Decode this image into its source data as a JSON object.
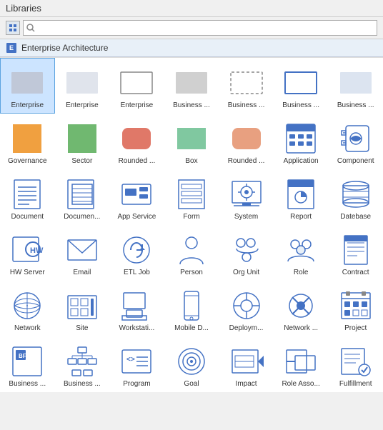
{
  "header": {
    "title": "Libraries",
    "search_placeholder": ""
  },
  "section": {
    "title": "Enterprise Architecture"
  },
  "grid": {
    "items": [
      {
        "id": "enterprise1",
        "label": "Enterprise",
        "icon": "enterprise-rect-filled"
      },
      {
        "id": "enterprise2",
        "label": "Enterprise",
        "icon": "enterprise-rect-light"
      },
      {
        "id": "enterprise3",
        "label": "Enterprise",
        "icon": "enterprise-rect-outline"
      },
      {
        "id": "business1",
        "label": "Business ...",
        "icon": "business-rect-grey"
      },
      {
        "id": "business2",
        "label": "Business ...",
        "icon": "business-rect-dashed"
      },
      {
        "id": "business3",
        "label": "Business ...",
        "icon": "business-rect-blue-outline"
      },
      {
        "id": "business4",
        "label": "Business ...",
        "icon": "business-rect-grey2"
      },
      {
        "id": "governance",
        "label": "Governance",
        "icon": "governance-orange"
      },
      {
        "id": "sector",
        "label": "Sector",
        "icon": "sector-green"
      },
      {
        "id": "rounded1",
        "label": "Rounded ...",
        "icon": "rounded-salmon"
      },
      {
        "id": "box",
        "label": "Box",
        "icon": "box-green"
      },
      {
        "id": "rounded2",
        "label": "Rounded ...",
        "icon": "rounded-peach"
      },
      {
        "id": "application",
        "label": "Application",
        "icon": "application"
      },
      {
        "id": "component",
        "label": "Component",
        "icon": "component"
      },
      {
        "id": "document",
        "label": "Document",
        "icon": "document"
      },
      {
        "id": "documentum",
        "label": "Documen...",
        "icon": "documentum"
      },
      {
        "id": "appservice",
        "label": "App Service",
        "icon": "appservice"
      },
      {
        "id": "form",
        "label": "Form",
        "icon": "form"
      },
      {
        "id": "system",
        "label": "System",
        "icon": "system"
      },
      {
        "id": "report",
        "label": "Report",
        "icon": "report"
      },
      {
        "id": "database",
        "label": "Datebase",
        "icon": "database"
      },
      {
        "id": "hwserver",
        "label": "HW Server",
        "icon": "hwserver"
      },
      {
        "id": "email",
        "label": "Email",
        "icon": "email"
      },
      {
        "id": "etljob",
        "label": "ETL Job",
        "icon": "etljob"
      },
      {
        "id": "person",
        "label": "Person",
        "icon": "person"
      },
      {
        "id": "orgunit",
        "label": "Org Unit",
        "icon": "orgunit"
      },
      {
        "id": "role",
        "label": "Role",
        "icon": "role"
      },
      {
        "id": "contract",
        "label": "Contract",
        "icon": "contract"
      },
      {
        "id": "network",
        "label": "Network",
        "icon": "network"
      },
      {
        "id": "site",
        "label": "Site",
        "icon": "site"
      },
      {
        "id": "workstation",
        "label": "Workstati...",
        "icon": "workstation"
      },
      {
        "id": "mobiledrive",
        "label": "Mobile D...",
        "icon": "mobiledrive"
      },
      {
        "id": "deployment",
        "label": "Deploym...",
        "icon": "deployment"
      },
      {
        "id": "networkdrive",
        "label": "Network ...",
        "icon": "networkdrive"
      },
      {
        "id": "project",
        "label": "Project",
        "icon": "project"
      },
      {
        "id": "businessfunc",
        "label": "Business ...",
        "icon": "businessfunc"
      },
      {
        "id": "businesshier",
        "label": "Business ...",
        "icon": "businesshier"
      },
      {
        "id": "program",
        "label": "Program",
        "icon": "program"
      },
      {
        "id": "goal",
        "label": "Goal",
        "icon": "goal"
      },
      {
        "id": "impact",
        "label": "Impact",
        "icon": "impact"
      },
      {
        "id": "roleasso",
        "label": "Role Asso...",
        "icon": "roleasso"
      },
      {
        "id": "fulfillment",
        "label": "Fulfillment",
        "icon": "fulfillment"
      }
    ]
  }
}
